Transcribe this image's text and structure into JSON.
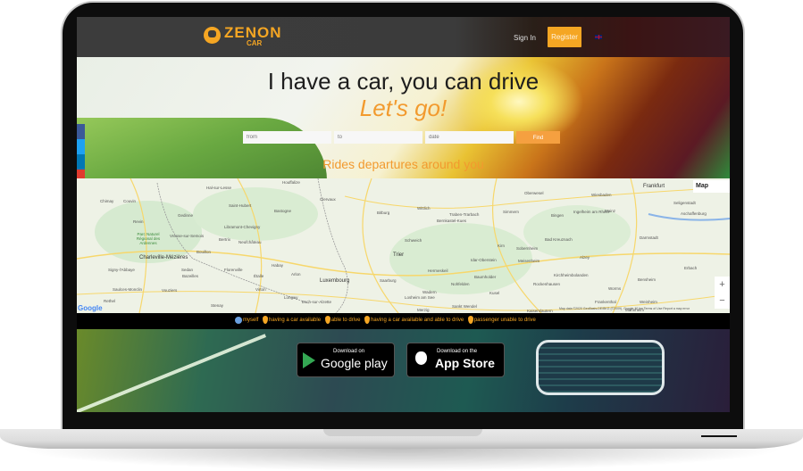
{
  "navbar": {
    "logo_text": "ZENON",
    "logo_sub": "CAR",
    "signin_label": "Sign In",
    "register_label": "Register",
    "language_flag": "uk-flag-icon"
  },
  "hero": {
    "title": "I have a car, you can drive",
    "subtitle": "Let's go!",
    "search": {
      "from_placeholder": "from",
      "to_placeholder": "to",
      "date_placeholder": "date",
      "find_label": "Find"
    },
    "rides_heading": "Rides departures around you"
  },
  "social": [
    {
      "name": "facebook-icon",
      "color": "#3b5998"
    },
    {
      "name": "twitter-icon",
      "color": "#1da1f2"
    },
    {
      "name": "linkedin-icon",
      "color": "#0077b5"
    },
    {
      "name": "pinterest-icon",
      "color": "#e03a2f"
    },
    {
      "name": "email-icon",
      "color": "#8a9a9a"
    }
  ],
  "map": {
    "type_label": "Map",
    "zoom_in": "+",
    "zoom_out": "−",
    "google": "Google",
    "attribution": "Map data ©2020 GeoBasis-DE/BKG (©2009), Google   10 km   Terms of Use   Report a map error",
    "labels": [
      {
        "t": "Hal-sur-Lesse"
      },
      {
        "t": "Houffalize"
      },
      {
        "t": "Chimay"
      },
      {
        "t": "Couvin"
      },
      {
        "t": "Saint-Hubert"
      },
      {
        "t": "Bastogne"
      },
      {
        "t": "Clervaux"
      },
      {
        "t": "Gedinne"
      },
      {
        "t": "Revin"
      },
      {
        "t": "Libramont-Chevigny"
      },
      {
        "t": "Parc Naturel Régional des Ardennes"
      },
      {
        "t": "Vresse-sur-Semois"
      },
      {
        "t": "Bertrix"
      },
      {
        "t": "Neufchâteau"
      },
      {
        "t": "Bouillon"
      },
      {
        "t": "Charleville-Mézières"
      },
      {
        "t": "Habay"
      },
      {
        "t": "Sedan"
      },
      {
        "t": "Bazeilles"
      },
      {
        "t": "Signy-l'Abbaye"
      },
      {
        "t": "Florenville"
      },
      {
        "t": "Étalle"
      },
      {
        "t": "Arlon"
      },
      {
        "t": "Saulces-Monclin"
      },
      {
        "t": "Vouziers"
      },
      {
        "t": "Virton"
      },
      {
        "t": "Luxembourg"
      },
      {
        "t": "Rethel"
      },
      {
        "t": "Longwy"
      },
      {
        "t": "Esch-sur-Alzette"
      },
      {
        "t": "Stenay"
      },
      {
        "t": "Bitburg"
      },
      {
        "t": "Wittlich"
      },
      {
        "t": "Traben-Trarbach"
      },
      {
        "t": "Bernkastel-Kues"
      },
      {
        "t": "Trier"
      },
      {
        "t": "Schweich"
      },
      {
        "t": "Kirn"
      },
      {
        "t": "Sobernheim"
      },
      {
        "t": "Idar-Oberstein"
      },
      {
        "t": "Meisenheim"
      },
      {
        "t": "Hermeskeil"
      },
      {
        "t": "Baumholder"
      },
      {
        "t": "Saarburg"
      },
      {
        "t": "Nohfelden"
      },
      {
        "t": "Wadern"
      },
      {
        "t": "Kusel"
      },
      {
        "t": "Losheim am See"
      },
      {
        "t": "Merzig"
      },
      {
        "t": "Sankt Wendel"
      },
      {
        "t": "Oberwesel"
      },
      {
        "t": "Simmern"
      },
      {
        "t": "Bingen"
      },
      {
        "t": "Ingelheim am Rhein"
      },
      {
        "t": "Bad Kreuznach"
      },
      {
        "t": "Alzey"
      },
      {
        "t": "Kirchheimbolanden"
      },
      {
        "t": "Rockenhausen"
      },
      {
        "t": "Kaiserslautern"
      },
      {
        "t": "Wiesbaden"
      },
      {
        "t": "Frankfurt"
      },
      {
        "t": "Mainz"
      },
      {
        "t": "Darmstadt"
      },
      {
        "t": "Seligenstadt"
      },
      {
        "t": "Aschaffenburg"
      },
      {
        "t": "Worms"
      },
      {
        "t": "Frankenthal"
      },
      {
        "t": "Weinheim"
      },
      {
        "t": "Mannheim"
      },
      {
        "t": "Bensheim"
      },
      {
        "t": "Erbach"
      }
    ]
  },
  "legend": {
    "items": [
      {
        "icon": "blue-dot-icon",
        "label": "myself"
      },
      {
        "icon": "pin-icon",
        "label": "having a car available"
      },
      {
        "icon": "pin-icon",
        "label": "able to drive"
      },
      {
        "icon": "pin-icon",
        "label": "having a car available and able to drive"
      },
      {
        "icon": "pin-icon",
        "label": "passenger unable to drive"
      }
    ]
  },
  "downloads": {
    "google_small": "Download on",
    "google_big": "Google play",
    "apple_small": "Download on the",
    "apple_big": "App Store"
  },
  "colors": {
    "accent": "#f5a623",
    "navbar": "#3c3c3c"
  }
}
